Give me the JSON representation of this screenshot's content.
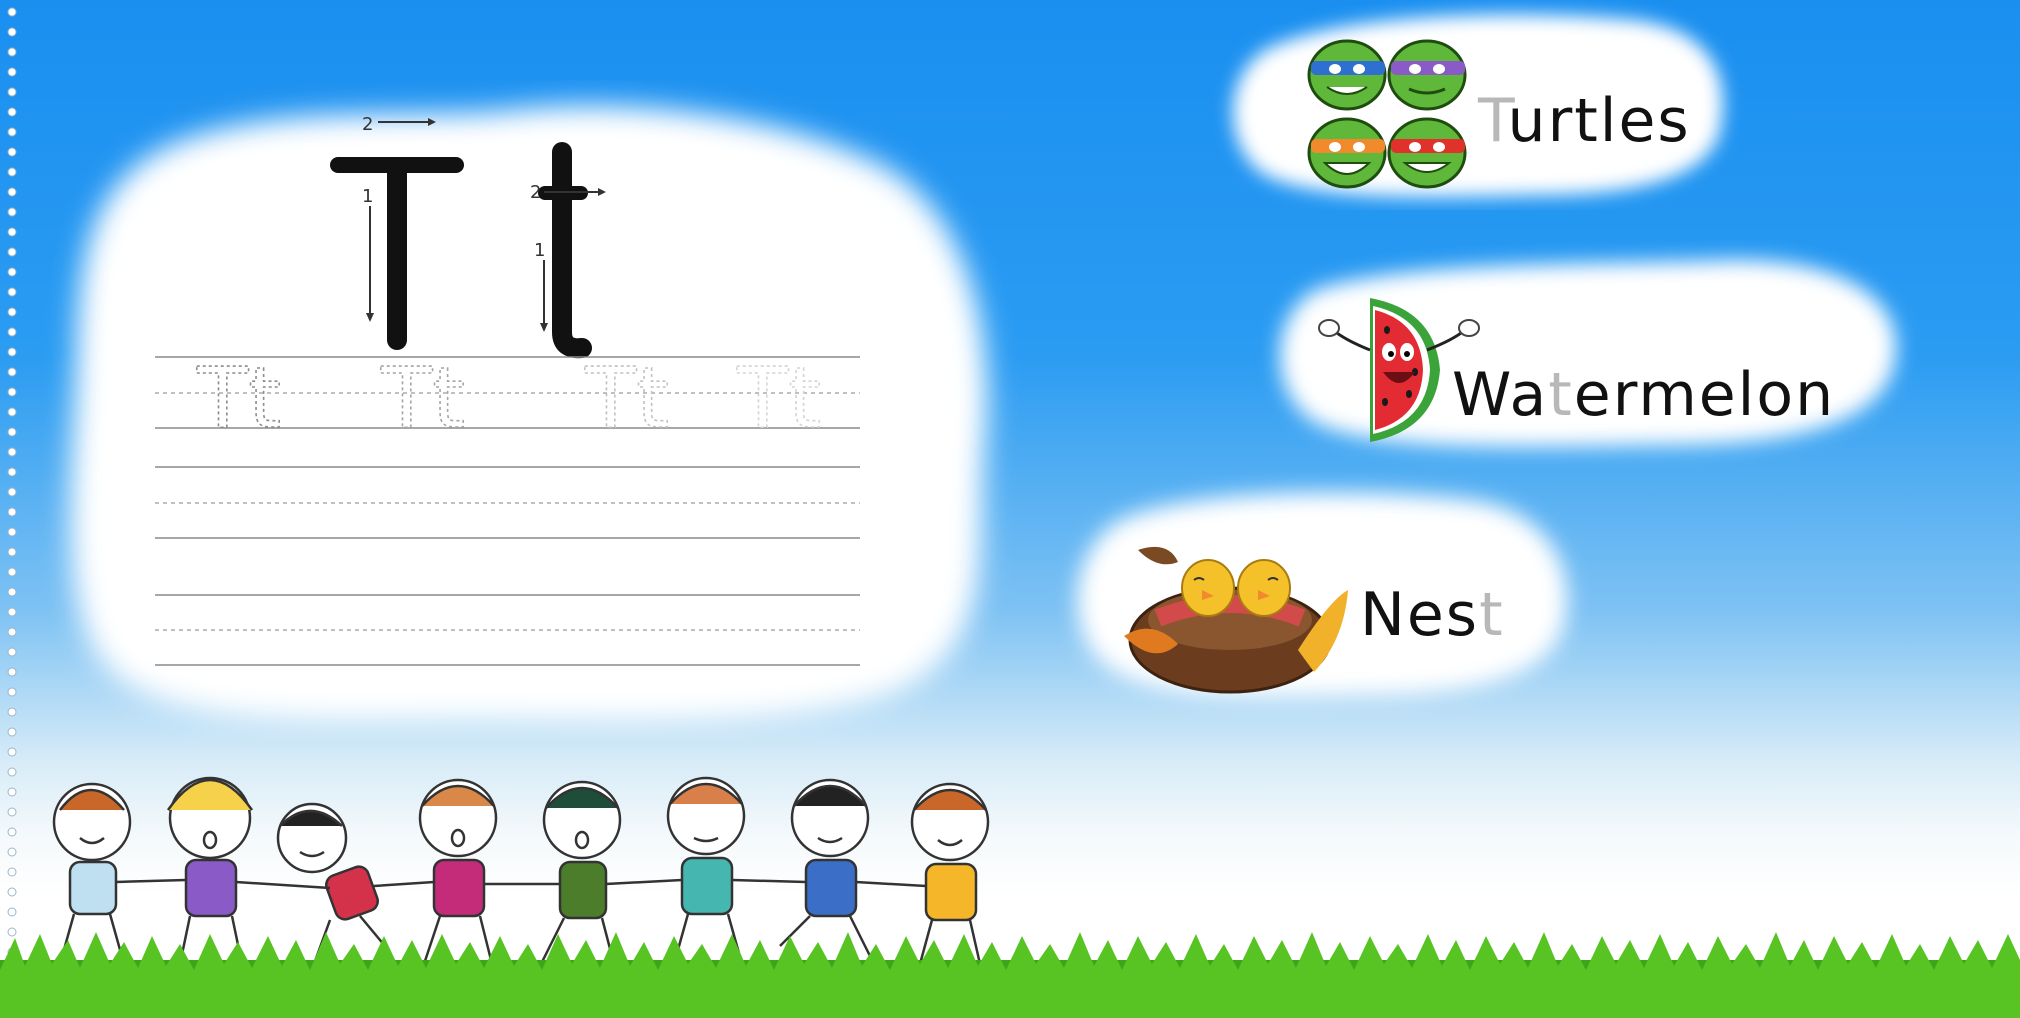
{
  "letter": {
    "upper": "T",
    "lower": "t",
    "stroke_1": "1",
    "stroke_2": "2",
    "trace_samples": [
      "Tt",
      "Tt",
      "Tt",
      "Tt"
    ]
  },
  "words": [
    {
      "first": "T",
      "rest": "urtles",
      "icon": "turtle-faces-icon"
    },
    {
      "before": "Wa",
      "highlight": "t",
      "after": "ermelon",
      "icon": "watermelon-icon"
    },
    {
      "before": "Nes",
      "highlight": "t",
      "icon": "bird-nest-icon"
    }
  ],
  "colors": {
    "sky_top": "#1a8ff0",
    "grass": "#49b51a",
    "ink": "#111111",
    "faint_letter": "#b8b8b8"
  }
}
